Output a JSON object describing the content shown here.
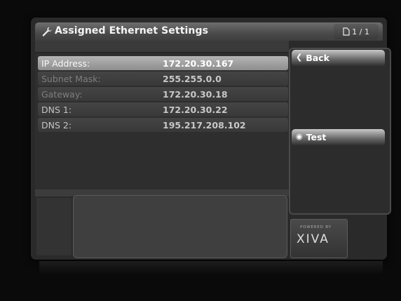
{
  "header": {
    "title": "Assigned Ethernet Settings",
    "page_indicator": "1 / 1"
  },
  "settings": [
    {
      "label": "IP Address:",
      "value": "172.20.30.167",
      "selected": true
    },
    {
      "label": "Subnet Mask:",
      "value": "255.255.0.0"
    },
    {
      "label": "Gateway:",
      "value": "172.20.30.18"
    },
    {
      "label": "DNS 1:",
      "value": "172.20.30.22"
    },
    {
      "label": "DNS 2:",
      "value": "195.217.208.102"
    }
  ],
  "side_buttons": {
    "back": "Back",
    "test": "Test"
  },
  "logo": {
    "powered_by": "POWERED BY",
    "brand": "XIVA"
  },
  "icons": {
    "title": "wrench-icon",
    "page": "page-icon",
    "back": "chevron-left-icon",
    "test": "radio-icon"
  }
}
